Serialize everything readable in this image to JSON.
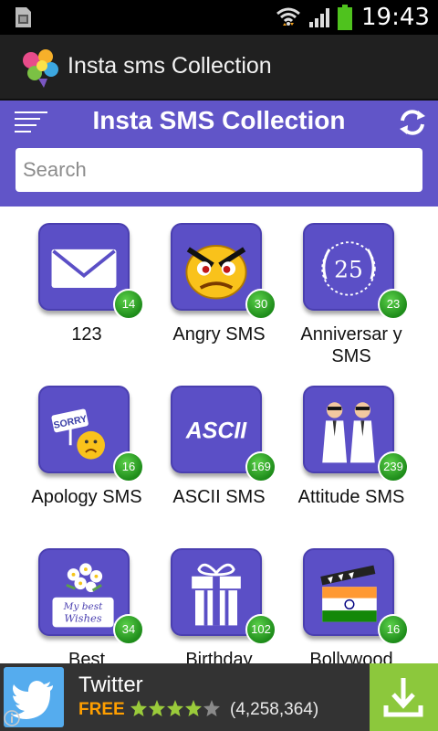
{
  "status_bar": {
    "time": "19:43"
  },
  "app_bar": {
    "title": "Insta sms Collection"
  },
  "header": {
    "title": "Insta SMS Collection"
  },
  "search": {
    "placeholder": "Search"
  },
  "categories": [
    {
      "label": "123",
      "count": "14",
      "icon": "envelope-icon"
    },
    {
      "label": "Angry SMS",
      "count": "30",
      "icon": "angry-face-icon"
    },
    {
      "label": "Anniversar y SMS",
      "count": "23",
      "icon": "anniversary-25-icon"
    },
    {
      "label": "Apology SMS",
      "count": "16",
      "icon": "sorry-sign-icon"
    },
    {
      "label": "ASCII SMS",
      "count": "169",
      "icon": "ascii-text-icon"
    },
    {
      "label": "Attitude SMS",
      "count": "239",
      "icon": "attitude-men-icon"
    },
    {
      "label": "Best",
      "count": "34",
      "icon": "flowers-best-wishes-icon"
    },
    {
      "label": "Birthday",
      "count": "102",
      "icon": "gift-box-icon"
    },
    {
      "label": "Bollywood",
      "count": "16",
      "icon": "clapperboard-flag-icon"
    }
  ],
  "ad": {
    "app_name": "Twitter",
    "price": "FREE",
    "rating_count": "(4,258,364)",
    "rating": 4,
    "rating_max": 5
  },
  "colors": {
    "header": "#6155c8",
    "tile": "#5b4fc6",
    "badge": "#2ea32a",
    "install": "#8cc83c",
    "twitter": "#55acee"
  }
}
